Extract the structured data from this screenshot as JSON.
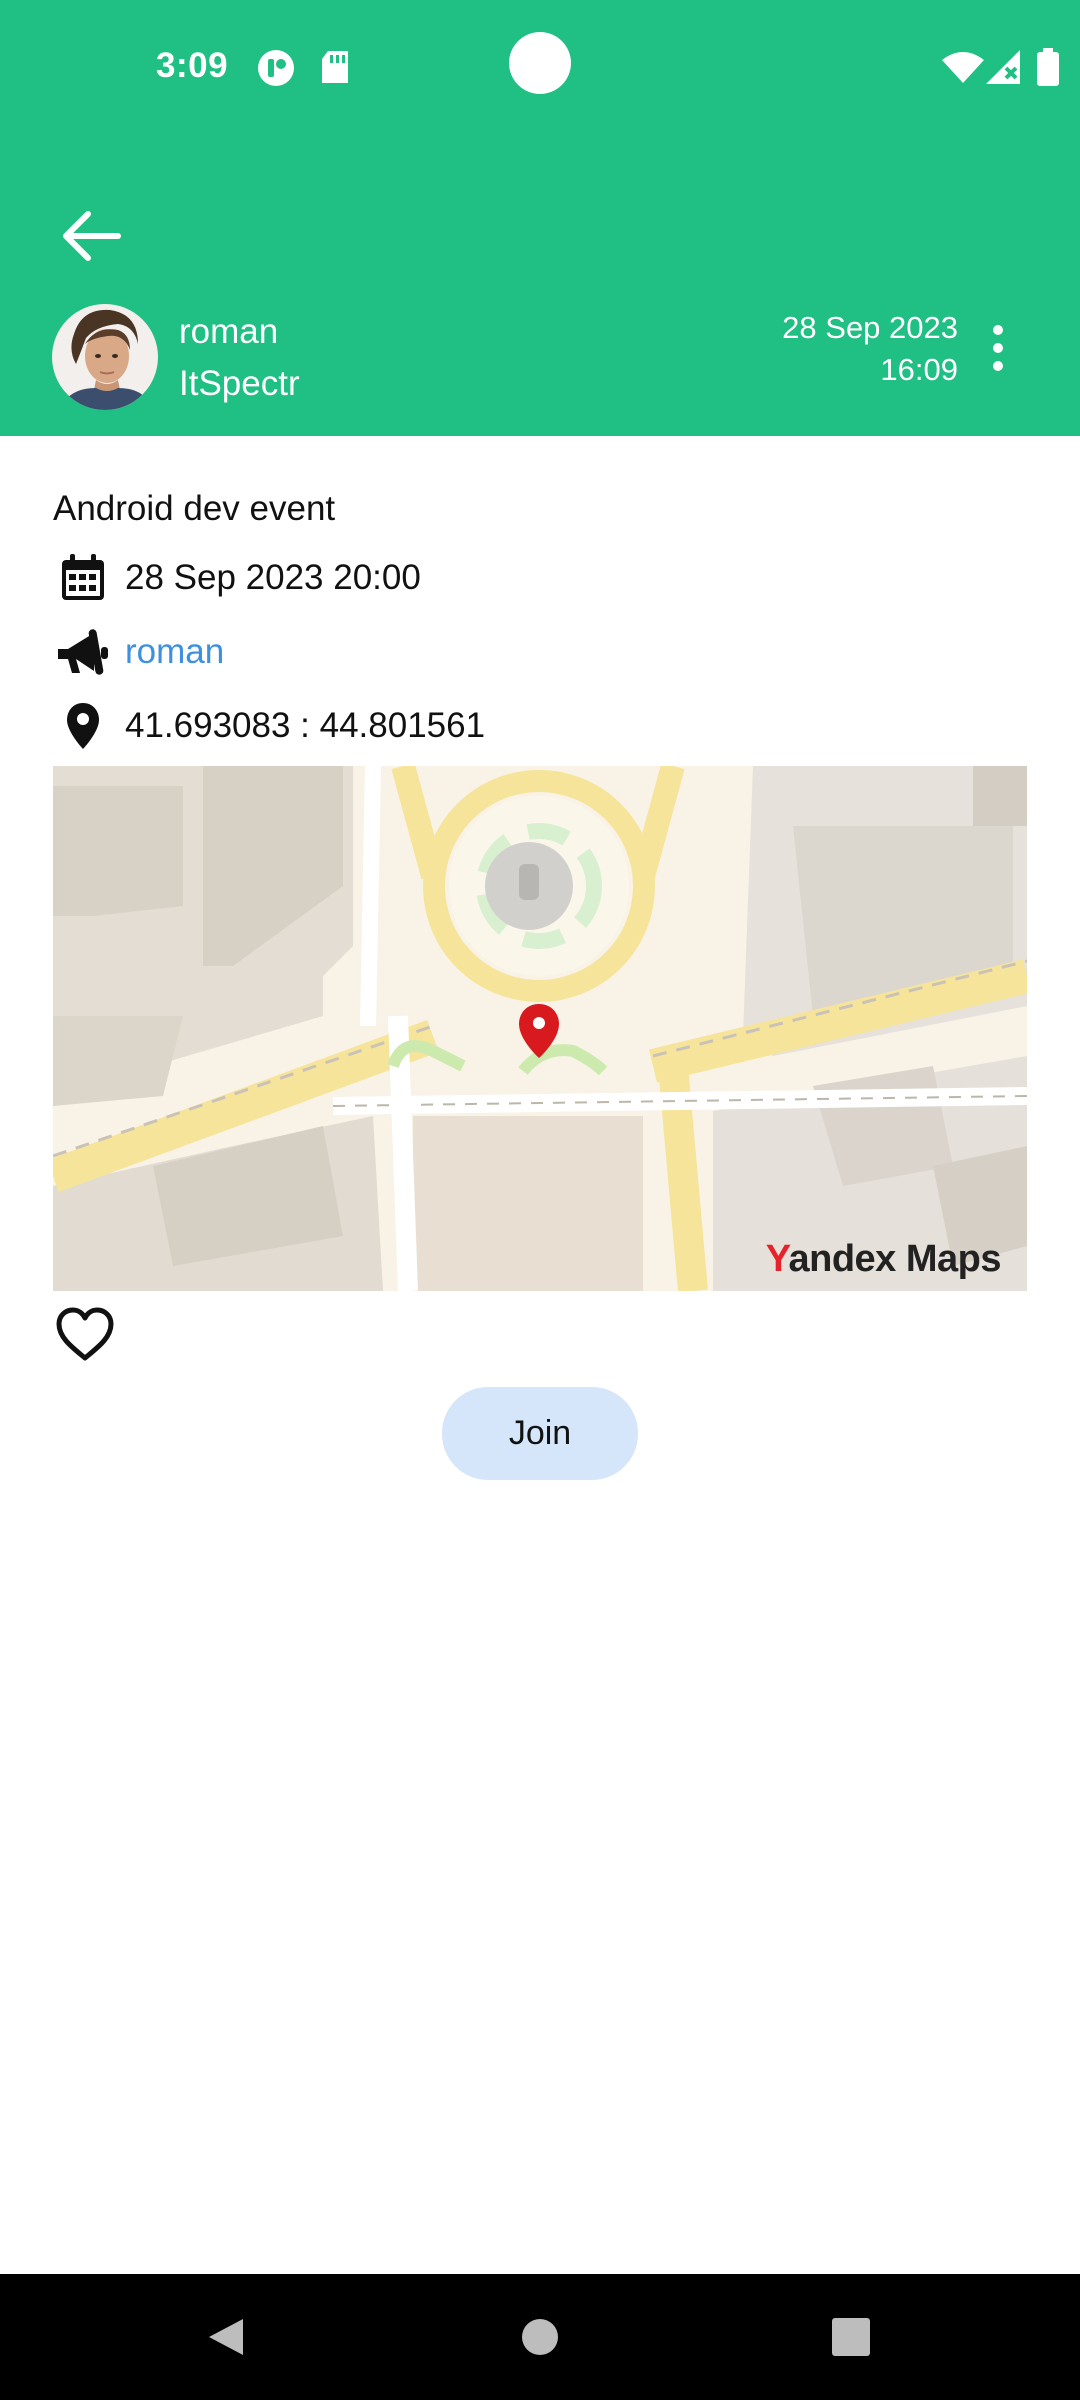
{
  "status_bar": {
    "time": "3:09",
    "icons": [
      "app-notification-icon",
      "sd-card-icon",
      "wifi-icon",
      "signal-no-data-icon",
      "battery-icon"
    ]
  },
  "header": {
    "back_icon": "arrow-left-icon",
    "author_name": "roman",
    "author_handle": "ItSpectr",
    "date": "28 Sep 2023",
    "time": "16:09",
    "more_icon": "more-vertical-icon"
  },
  "event": {
    "title": "Android dev event",
    "datetime": "28 Sep 2023 20:00",
    "organizer": "roman",
    "coordinates": "41.693083 : 44.801561"
  },
  "map": {
    "brand_first": "Y",
    "brand_rest": "andex Maps",
    "pin_icon": "map-pin-icon"
  },
  "actions": {
    "like_icon": "heart-outline-icon",
    "join_label": "Join"
  },
  "nav": {
    "icons": [
      "back-triangle-icon",
      "home-circle-icon",
      "recents-square-icon"
    ]
  },
  "colors": {
    "header": "#20bf84",
    "link": "#3d8fe0",
    "join_button": "#d5e6fb",
    "map_pin": "#d8191d"
  }
}
